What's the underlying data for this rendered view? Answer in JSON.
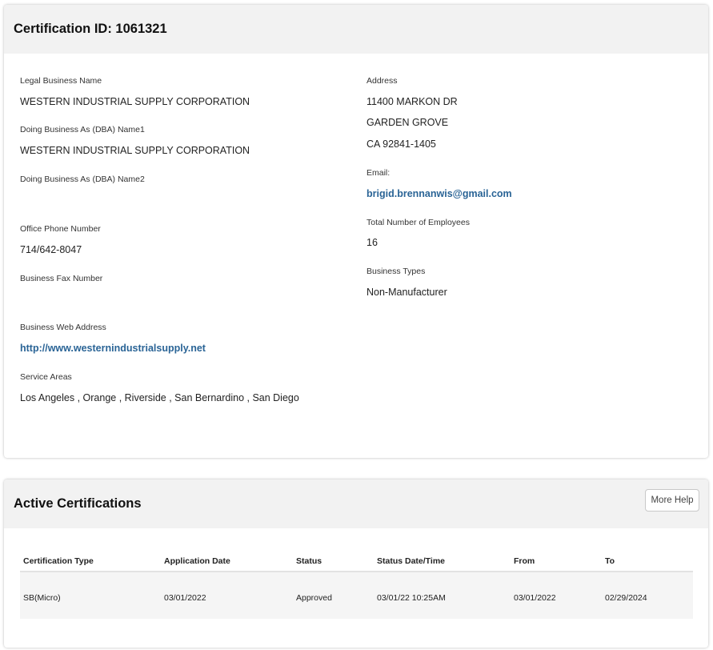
{
  "certification": {
    "title": "Certification ID: 1061321",
    "left": {
      "legal_name_label": "Legal Business Name",
      "legal_name_value": "WESTERN INDUSTRIAL SUPPLY CORPORATION",
      "dba1_label": "Doing Business As (DBA) Name1",
      "dba1_value": "WESTERN INDUSTRIAL SUPPLY CORPORATION",
      "dba2_label": "Doing Business As (DBA) Name2",
      "phone_label": "Office Phone Number",
      "phone_value": "714/642-8047",
      "fax_label": "Business Fax Number",
      "web_label": "Business Web Address",
      "web_value": "http://www.westernindustrialsupply.net",
      "service_label": "Service Areas",
      "service_value": "Los Angeles , Orange , Riverside , San Bernardino , San Diego"
    },
    "right": {
      "address_label": "Address",
      "address_line1": "11400 MARKON DR",
      "address_line2": "GARDEN GROVE",
      "address_line3": "CA 92841-1405",
      "email_label": "Email:",
      "email_value": "brigid.brennanwis@gmail.com",
      "employees_label": "Total Number of Employees",
      "employees_value": "16",
      "business_types_label": "Business Types",
      "business_types_value": "Non-Manufacturer"
    }
  },
  "active": {
    "title": "Active Certifications",
    "help_button": "More Help",
    "columns": [
      "Certification Type",
      "Application Date",
      "Status",
      "Status Date/Time",
      "From",
      "To"
    ],
    "rows": [
      [
        "SB(Micro)",
        "03/01/2022",
        "Approved",
        "03/01/22 10:25AM",
        "03/01/2022",
        "02/29/2024"
      ]
    ]
  }
}
